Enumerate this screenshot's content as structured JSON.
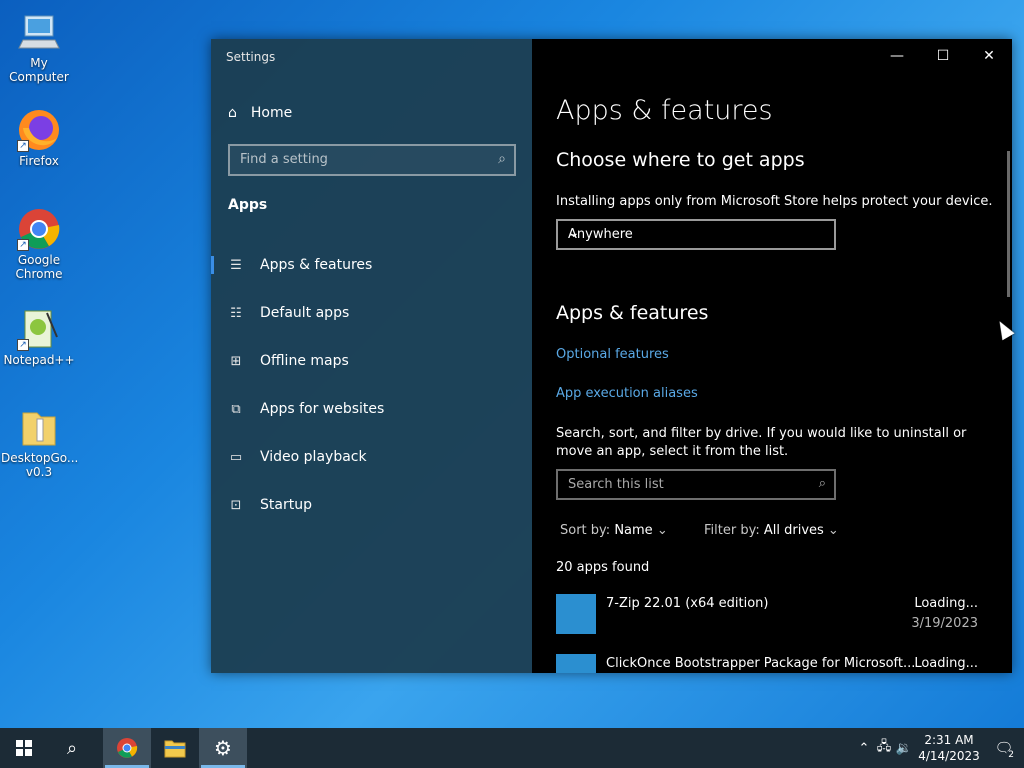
{
  "desktop": {
    "icons": [
      {
        "label": "My Computer"
      },
      {
        "label": "Firefox"
      },
      {
        "label": "Google Chrome"
      },
      {
        "label": "Notepad++"
      },
      {
        "label": "DesktopGo... v0.3"
      }
    ]
  },
  "window": {
    "title": "Settings",
    "controls": {
      "minimize": "—",
      "maximize": "☐",
      "close": "✕"
    }
  },
  "sidebar": {
    "home_label": "Home",
    "search_placeholder": "Find a setting",
    "section_title": "Apps",
    "items": [
      {
        "label": "Apps & features",
        "icon": "list-icon"
      },
      {
        "label": "Default apps",
        "icon": "default-apps-icon"
      },
      {
        "label": "Offline maps",
        "icon": "map-icon"
      },
      {
        "label": "Apps for websites",
        "icon": "link-window-icon"
      },
      {
        "label": "Video playback",
        "icon": "video-icon"
      },
      {
        "label": "Startup",
        "icon": "startup-icon"
      }
    ]
  },
  "main": {
    "page_title": "Apps & features",
    "choose_heading": "Choose where to get apps",
    "choose_desc": "Installing apps only from Microsoft Store helps protect your device.",
    "source_dropdown": "Anywhere",
    "section_heading": "Apps & features",
    "optional_features": "Optional features",
    "execution_aliases": "App execution aliases",
    "search_desc": "Search, sort, and filter by drive. If you would like to uninstall or move an app, select it from the list.",
    "search_placeholder": "Search this list",
    "sort_label": "Sort by:",
    "sort_value": "Name",
    "filter_label": "Filter by:",
    "filter_value": "All drives",
    "apps_count": "20 apps found",
    "apps": [
      {
        "name": "7-Zip 22.01 (x64 edition)",
        "size": "Loading...",
        "date": "3/19/2023"
      },
      {
        "name": "ClickOnce Bootstrapper Package for Microsoft...",
        "size": "Loading...",
        "date": ""
      }
    ]
  },
  "taskbar": {
    "time": "2:31 AM",
    "date": "4/14/2023",
    "notification_count": "2"
  }
}
